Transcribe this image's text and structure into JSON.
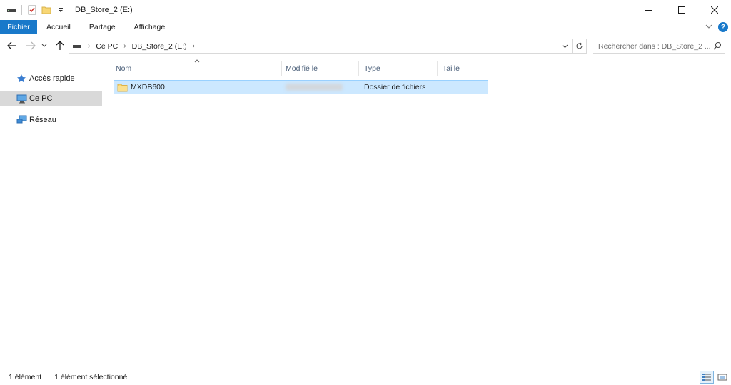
{
  "window": {
    "title": "DB_Store_2 (E:)"
  },
  "ribbon": {
    "tabs": [
      {
        "label": "Fichier"
      },
      {
        "label": "Accueil"
      },
      {
        "label": "Partage"
      },
      {
        "label": "Affichage"
      }
    ]
  },
  "address": {
    "crumbs": [
      "Ce PC",
      "DB_Store_2 (E:)"
    ]
  },
  "search": {
    "placeholder": "Rechercher dans : DB_Store_2 ..."
  },
  "navpane": {
    "items": [
      {
        "label": "Accès rapide",
        "icon": "star-icon"
      },
      {
        "label": "Ce PC",
        "icon": "computer-icon"
      },
      {
        "label": "Réseau",
        "icon": "network-icon"
      }
    ]
  },
  "columns": {
    "name": "Nom",
    "modified": "Modifié le",
    "type": "Type",
    "size": "Taille"
  },
  "files": [
    {
      "name": "MXDB600",
      "type": "Dossier de fichiers",
      "icon": "folder-icon"
    }
  ],
  "status": {
    "count": "1 élément",
    "selected": "1 élément sélectionné"
  },
  "colors": {
    "accent": "#1979ca",
    "selection": "#cce8ff",
    "folder": "#f8d775"
  }
}
